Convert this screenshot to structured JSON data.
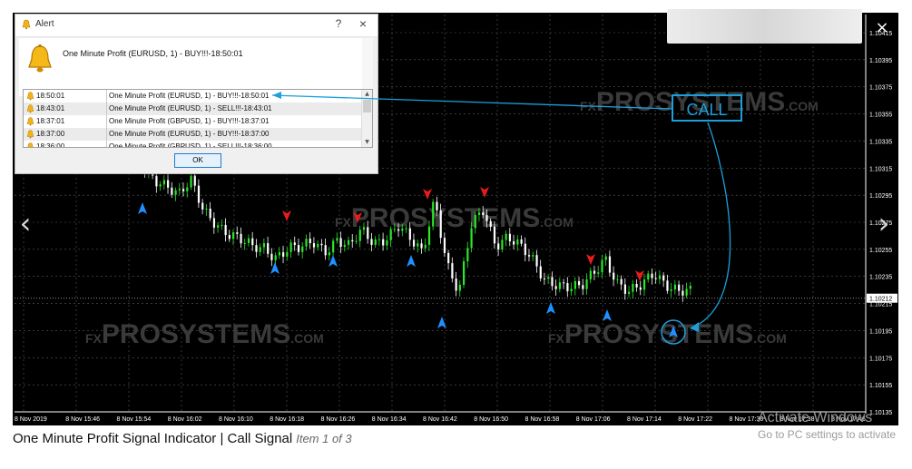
{
  "chart": {
    "price_labels": [
      "1.10415",
      "1.10395",
      "1.10375",
      "1.10355",
      "1.10335",
      "1.10315",
      "1.10295",
      "1.10275",
      "1.10255",
      "1.10235",
      "1.10215",
      "1.10195",
      "1.10175",
      "1.10155",
      "1.10135"
    ],
    "current_price": "1.10212",
    "time_labels": [
      "8 Nov 2019",
      "8 Nov 15:46",
      "8 Nov 15:54",
      "8 Nov 16:02",
      "8 Nov 16:10",
      "8 Nov 16:18",
      "8 Nov 16:26",
      "8 Nov 16:34",
      "8 Nov 16:42",
      "8 Nov 16:50",
      "8 Nov 16:58",
      "8 Nov 17:06",
      "8 Nov 17:14",
      "8 Nov 17:22",
      "8 Nov 17:30",
      "8 Nov 17:38",
      "8 Nov 17:46"
    ],
    "watermark_prefix": "FX",
    "watermark": "PROSYSTEMS",
    "watermark_suffix": ".COM",
    "colors": {
      "bull": "#29e829",
      "bear": "#ffffff",
      "buy_arrow": "#1e90ff",
      "sell_arrow": "#e81c1c",
      "grid": "#5a5a5a",
      "call": "#1ba0dc"
    }
  },
  "call_label": "CALL",
  "alert": {
    "title": "Alert",
    "help": "?",
    "close": "×",
    "message": "One Minute Profit (EURUSD, 1)  - BUY!!!-18:50:01",
    "rows": [
      {
        "time": "18:50:01",
        "message": "One Minute Profit (EURUSD, 1)  - BUY!!!-18:50:01"
      },
      {
        "time": "18:43:01",
        "message": "One Minute Profit (EURUSD, 1)  - SELL!!!-18:43:01"
      },
      {
        "time": "18:37:01",
        "message": "One Minute Profit (GBPUSD, 1)  - BUY!!!-18:37:01"
      },
      {
        "time": "18:37:00",
        "message": "One Minute Profit (EURUSD, 1)  - BUY!!!-18:37:00"
      },
      {
        "time": "18:36:00",
        "message": "One Minute Profit (GBPUSD, 1)  - SELL!!!-18:36:00"
      }
    ],
    "ok_label": "OK"
  },
  "nav": {
    "prev": "‹",
    "next": "›",
    "close": "×"
  },
  "caption": {
    "title": "One Minute Profit Signal Indicator | Call Signal",
    "item": "Item 1 of 3"
  },
  "activate": {
    "line1": "Activate Windows",
    "line2": "Go to PC settings to activate"
  },
  "chart_data": {
    "type": "candlestick",
    "x": [
      "8 Nov 2019",
      "8 Nov 15:46",
      "8 Nov 15:54",
      "8 Nov 16:02",
      "8 Nov 16:10",
      "8 Nov 16:18",
      "8 Nov 16:26",
      "8 Nov 16:34",
      "8 Nov 16:42",
      "8 Nov 16:50",
      "8 Nov 16:58",
      "8 Nov 17:06",
      "8 Nov 17:14",
      "8 Nov 17:22",
      "8 Nov 17:30",
      "8 Nov 17:38",
      "8 Nov 17:46"
    ],
    "close_path": [
      1.10325,
      1.10318,
      1.10312,
      1.10305,
      1.103,
      1.1029,
      1.103,
      1.1028,
      1.10272,
      1.10262,
      1.10255,
      1.1025,
      1.10252,
      1.10245,
      1.1025,
      1.10248,
      1.10255,
      1.1025,
      1.10258,
      1.1025,
      1.10262,
      1.10255,
      1.1026,
      1.10268,
      1.10255,
      1.10245,
      1.1029,
      1.1024,
      1.10215,
      1.10265,
      1.1028,
      1.10255,
      1.1026,
      1.1025,
      1.1024,
      1.10228,
      1.10225,
      1.1022,
      1.10218,
      1.1023,
      1.10245,
      1.10225,
      1.10215,
      1.1022,
      1.10232,
      1.10225,
      1.10218,
      1.10215
    ],
    "ylim": [
      1.10125,
      1.10425
    ],
    "buy_signals": [
      6,
      19,
      26,
      31,
      37,
      53,
      72,
      80,
      88
    ],
    "sell_signals": [
      20,
      27,
      33,
      36,
      45,
      53
    ],
    "call_signal_index": 47,
    "current_price": 1.10212,
    "grid": true
  }
}
